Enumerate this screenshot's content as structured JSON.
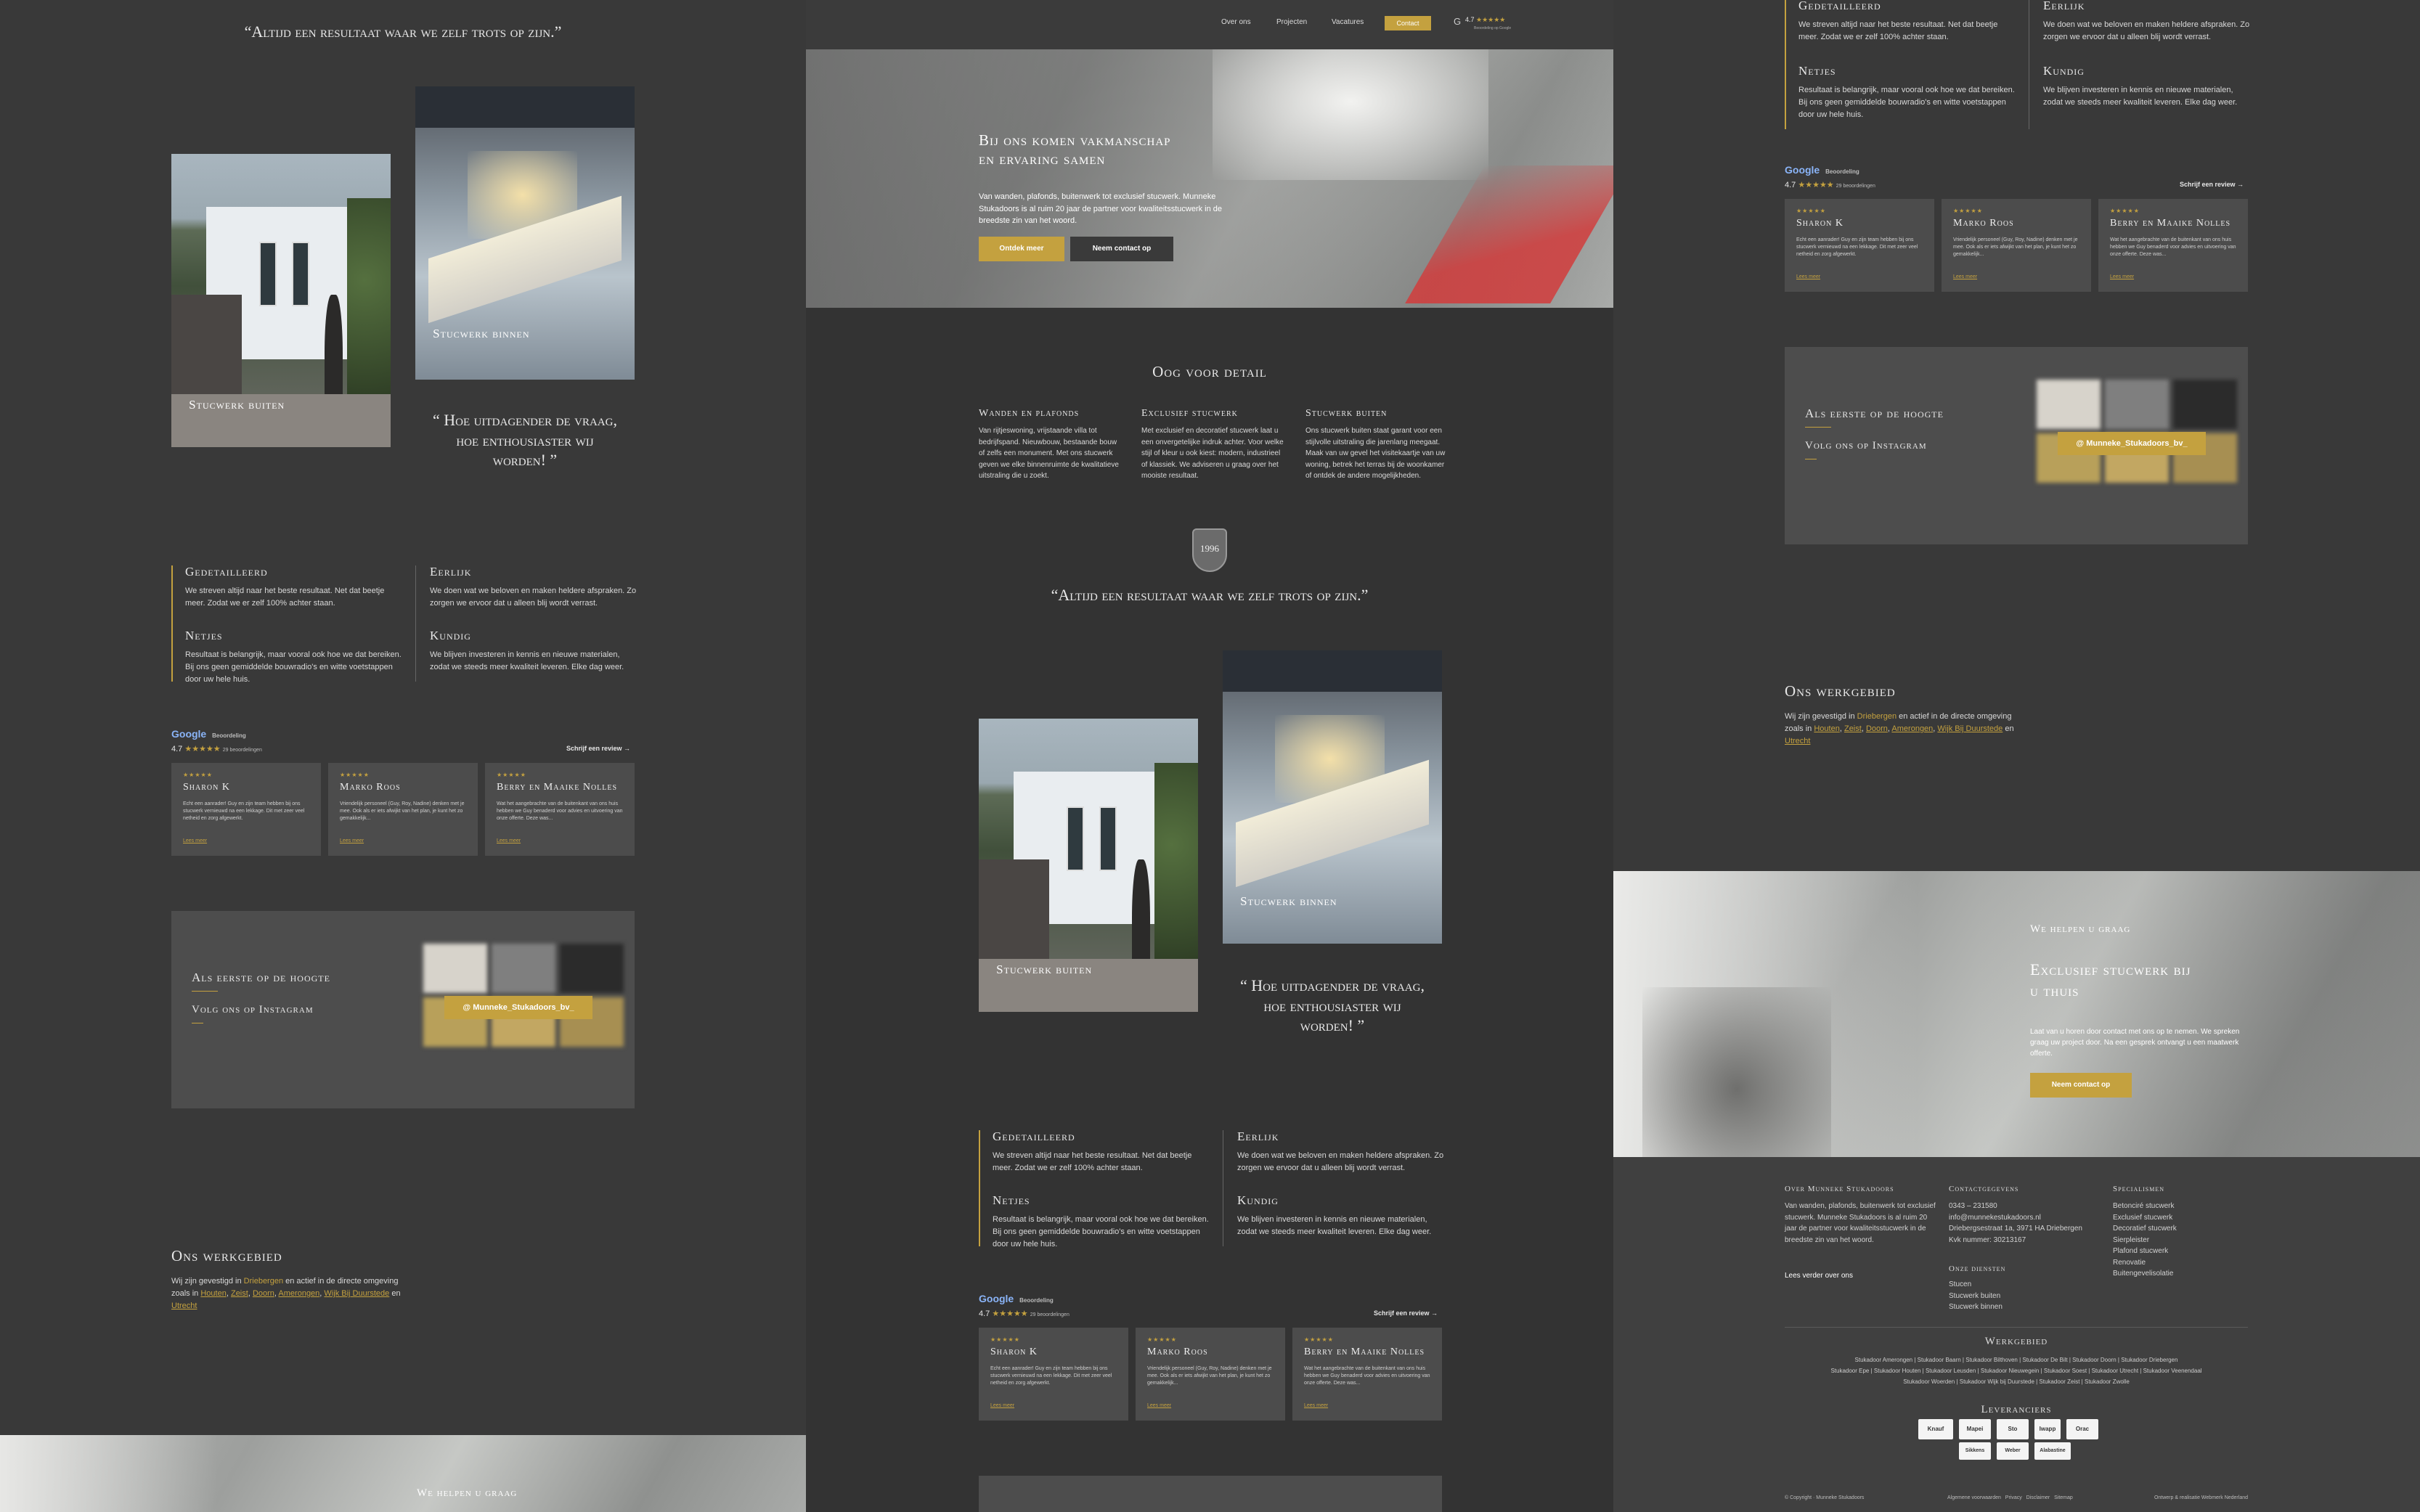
{
  "brand": {
    "logo_year": "1996",
    "accent": "#c4a13f",
    "bg": "#3a3a3a"
  },
  "nav": {
    "items": [
      "Over ons",
      "Projecten",
      "Vacatures",
      "Contact"
    ],
    "rating": "4.7",
    "rating_sub": "Beoordeling op Google"
  },
  "hero": {
    "title_line1": "Bij ons komen vakmanschap",
    "title_line2": "en ervaring samen",
    "text": "Van wanden, plafonds, buitenwerk tot exclusief stucwerk. Munneke Stukadoors is al ruim 20 jaar de partner voor kwaliteitsstucwerk in de breedste zin van het woord.",
    "btn_primary": "Ontdek meer",
    "btn_secondary": "Neem contact op"
  },
  "detail": {
    "title": "Oog voor detail",
    "columns": [
      {
        "title": "Wanden en plafonds",
        "text": "Van rijtjeswoning, vrijstaande villa tot bedrijfspand. Nieuwbouw, bestaande bouw of zelfs een monument. Met ons stucwerk geven we elke binnenruimte de kwalitatieve uitstraling die u zoekt."
      },
      {
        "title": "Exclusief stucwerk",
        "text": "Met exclusief en decoratief stucwerk laat u een onvergetelijke indruk achter. Voor welke stijl of kleur u ook kiest: modern, industrieel of klassiek. We adviseren u graag over het mooiste resultaat."
      },
      {
        "title": "Stucwerk buiten",
        "text": "Ons stucwerk buiten staat garant voor een stijlvolle uitstraling die jarenlang meegaat. Maak van uw gevel het visitekaartje van uw woning, betrek het terras bij de woonkamer of ontdek de andere mogelijkheden."
      }
    ]
  },
  "quote": "“Altijd een resultaat waar we zelf trots op zijn.”",
  "photos": {
    "outside": "Stucwerk buiten",
    "inside": "Stucwerk binnen"
  },
  "challenge_quote": "“ Hoe uitdagender de vraag, hoe enthousiaster wij worden! ”",
  "values": [
    {
      "title": "Gedetailleerd",
      "text": "We streven altijd naar het beste resultaat. Net dat beetje meer. Zodat we er zelf 100% achter staan."
    },
    {
      "title": "Eerlijk",
      "text": "We doen wat we beloven en maken heldere afspraken. Zo zorgen we ervoor dat u alleen blij wordt verrast."
    },
    {
      "title": "Netjes",
      "text": "Resultaat is belangrijk, maar vooral ook hoe we dat bereiken. Bij ons geen gemiddelde bouwradio's en witte voetstappen door uw hele huis."
    },
    {
      "title": "Kundig",
      "text": "We blijven investeren in kennis en nieuwe materialen, zodat we steeds meer kwaliteit leveren. Elke dag weer."
    }
  ],
  "reviews": {
    "google_label": "Google",
    "google_sub": "Beoordeling",
    "score": "4.7",
    "count": "29 beoordelingen",
    "write": "Schrijf een review →",
    "read_more": "Lees meer",
    "items": [
      {
        "stars": "★★★★★",
        "name": "Sharon K",
        "text": "Echt een aanrader! Guy en zijn team hebben bij ons stucwerk vernieuwd na een lekkage. Dit met zeer veel netheid en zorg afgewerkt."
      },
      {
        "stars": "★★★★★",
        "name": "Marko Roos",
        "text": "Vriendelijk personeel (Guy, Roy, Nadine) denken met je mee. Ook als er iets afwijkt van het plan, je kunt het zo gemakkelijk..."
      },
      {
        "stars": "★★★★★",
        "name": "Berry en Maaike Nolles",
        "text": "Wat het aangebrachte van de buitenkant van ons huis hebben we Guy benaderd voor advies en uitvoering van onze offerte. Deze was..."
      }
    ]
  },
  "instagram": {
    "title": "Als eerste op de hoogte",
    "subtitle": "Volg ons op Instagram",
    "handle": "@ Munneke_Stukadoors_bv_"
  },
  "area": {
    "title": "Ons werkgebied",
    "text_pre": "Wij zijn gevestigd in",
    "home": "Driebergen",
    "text_mid": "en actief in de directe omgeving zoals in",
    "places": [
      "Houten",
      "Zeist",
      "Doorn",
      "Amerongen",
      "Wijk Bij Duurstede"
    ],
    "and": "en",
    "last": "Utrecht"
  },
  "cta": {
    "kicker": "We helpen u graag",
    "title_line1": "Exclusief stucwerk bij",
    "title_line2": "u thuis",
    "text": "Laat van u horen door contact met ons op te nemen. We spreken graag uw project door. Na een gesprek ontvangt u een maatwerk offerte.",
    "button": "Neem contact op"
  },
  "footer": {
    "about_title": "Over Munneke Stukadoors",
    "about_text": "Van wanden, plafonds, buitenwerk tot exclusief stucwerk. Munneke Stukadoors is al ruim 20 jaar de partner voor kwaliteitsstucwerk in de breedste zin van het woord.",
    "about_link": "Lees verder over ons",
    "contact_title": "Contactgegevens",
    "phone": "0343 – 231580",
    "email": "info@munnekestukadoors.nl",
    "address": "Driebergsestraat 1a, 3971 HA Driebergen",
    "kvk": "Kvk nummer: 30213167",
    "services_title": "Onze diensten",
    "services": [
      "Stucen",
      "Stucwerk buiten",
      "Stucwerk binnen"
    ],
    "specialisms_title": "Specialismen",
    "specialisms": [
      "Betonciré stucwerk",
      "Exclusief stucwerk",
      "Decoratief stucwerk",
      "Sierpleister",
      "Plafond stucwerk",
      "Renovatie",
      "Buitengevelisolatie"
    ],
    "region_title": "Werkgebied",
    "region_row1": [
      "Stukadoor Amerongen",
      "Stukadoor Baarn",
      "Stukadoor Bilthoven",
      "Stukadoor De Bilt",
      "Stukadoor Doorn",
      "Stukadoor Driebergen"
    ],
    "region_row2": [
      "Stukadoor Epe",
      "Stukadoor Houten",
      "Stukadoor Leusden",
      "Stukadoor Nieuwegein",
      "Stukadoor Soest",
      "Stukadoor Utrecht",
      "Stukadoor Veenendaal"
    ],
    "region_row3": [
      "Stukadoor Woerden",
      "Stukadoor Wijk bij Duurstede",
      "Stukadoor Zeist",
      "Stukadoor Zwolle"
    ],
    "suppliers_title": "Leveranciers",
    "suppliers": [
      "Knauf",
      "Mapei",
      "Sto",
      "Iwapp",
      "Orac",
      "Sikkens",
      "Weber",
      "Alabastine"
    ],
    "copyright": "© Copyright · Munneke Stukadoors",
    "legal": [
      "Algemene voorwaarden",
      "Privacy",
      "Disclaimer",
      "Sitemap"
    ],
    "credit": "Ontwerp & realisatie Webmerk Nederland"
  }
}
